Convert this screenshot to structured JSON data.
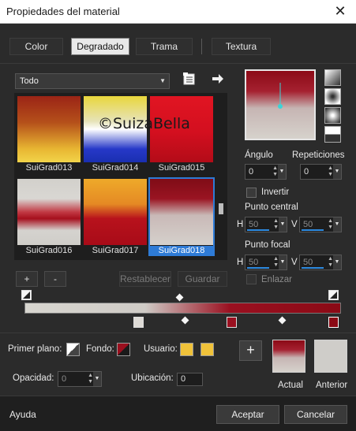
{
  "window": {
    "title": "Propiedades del material",
    "close_glyph": "✕"
  },
  "tabs": [
    {
      "label": "Color"
    },
    {
      "label": "Degradado"
    },
    {
      "label": "Trama"
    },
    {
      "label": "Textura"
    }
  ],
  "category_dropdown": {
    "value": "Todo"
  },
  "watermark": "©SuizaBella",
  "gradients": [
    {
      "name": "SuiGrad013",
      "selected": false
    },
    {
      "name": "SuiGrad014",
      "selected": false
    },
    {
      "name": "SuiGrad015",
      "selected": false
    },
    {
      "name": "SuiGrad016",
      "selected": false
    },
    {
      "name": "SuiGrad017",
      "selected": false
    },
    {
      "name": "SuiGrad018",
      "selected": true
    }
  ],
  "gallery_buttons": {
    "add": "+",
    "remove": "-",
    "reset": "Restablecer",
    "save": "Guardar"
  },
  "angle": {
    "label": "Ángulo",
    "value": "0"
  },
  "repetitions": {
    "label": "Repeticiones",
    "value": "0"
  },
  "invert": {
    "label": "Invertir",
    "checked": false
  },
  "center_point": {
    "label": "Punto central",
    "h_label": "H",
    "h_value": "50",
    "v_label": "V",
    "v_value": "50"
  },
  "focal_point": {
    "label": "Punto focal",
    "h_label": "H",
    "h_value": "50",
    "v_label": "V",
    "v_value": "50"
  },
  "link": {
    "label": "Enlazar",
    "checked": false
  },
  "colors": {
    "foreground_label": "Primer plano:",
    "background_label": "Fondo:",
    "user_label": "Usuario:",
    "user_color": "#f0c23a",
    "background_color": "#9a0f1e"
  },
  "opacity": {
    "label": "Opacidad:",
    "value": "0"
  },
  "location": {
    "label": "Ubicación:",
    "value": "0"
  },
  "add_swatch": "+",
  "current": {
    "label": "Actual"
  },
  "previous": {
    "label": "Anterior"
  },
  "footer": {
    "help": "Ayuda",
    "ok": "Aceptar",
    "cancel": "Cancelar"
  }
}
